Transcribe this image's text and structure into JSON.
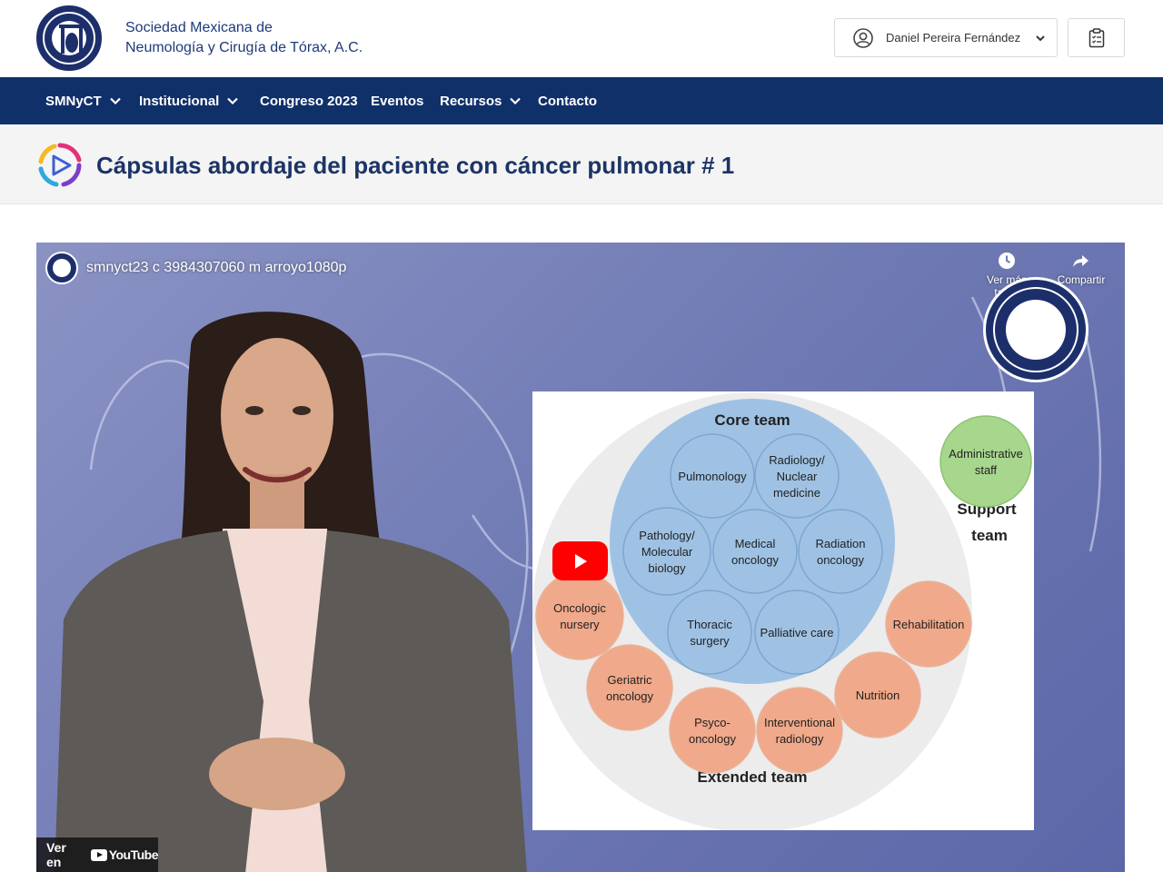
{
  "header": {
    "org_name_line1": "Sociedad Mexicana de",
    "org_name_line2": "Neumología y Cirugía de Tórax, A.C.",
    "user_name": "Daniel Pereira Fernández"
  },
  "nav": {
    "items": [
      {
        "label": "SMNyCT",
        "has_dropdown": true
      },
      {
        "label": "Institucional",
        "has_dropdown": true
      },
      {
        "label": "Congreso 2023",
        "has_dropdown": false
      },
      {
        "label": "Eventos",
        "has_dropdown": false
      },
      {
        "label": "Recursos",
        "has_dropdown": true
      },
      {
        "label": "Contacto",
        "has_dropdown": false
      }
    ]
  },
  "page": {
    "title": "Cápsulas abordaje del paciente con cáncer pulmonar # 1"
  },
  "video": {
    "title": "smnyct23 c 3984307060 m arroyo1080p",
    "watch_later_label": "Ver más tarde",
    "share_label": "Compartir",
    "watch_on_label": "Ver en",
    "youtube_label": "YouTube"
  },
  "slide": {
    "core_team_title": "Core team",
    "extended_team_title": "Extended team",
    "support_team_line1": "Support",
    "support_team_line2": "team",
    "core_circles": [
      {
        "lines": [
          "Pulmonology"
        ]
      },
      {
        "lines": [
          "Radiology/",
          "Nuclear",
          "medicine"
        ]
      },
      {
        "lines": [
          "Pathology/",
          "Molecular",
          "biology"
        ]
      },
      {
        "lines": [
          "Medical",
          "oncology"
        ]
      },
      {
        "lines": [
          "Radiation",
          "oncology"
        ]
      },
      {
        "lines": [
          "Thoracic",
          "surgery"
        ]
      },
      {
        "lines": [
          "Palliative care"
        ]
      }
    ],
    "extended_circles": [
      {
        "lines": [
          "Oncologic",
          "nursery"
        ]
      },
      {
        "lines": [
          "Geriatric",
          "oncology"
        ]
      },
      {
        "lines": [
          "Psyco-",
          "oncology"
        ]
      },
      {
        "lines": [
          "Interventional",
          "radiology"
        ]
      },
      {
        "lines": [
          "Nutrition"
        ]
      },
      {
        "lines": [
          "Rehabilitation"
        ]
      }
    ],
    "support_circle": {
      "lines": [
        "Administrative",
        "staff"
      ]
    }
  },
  "colors": {
    "nav_bg": "#10306a",
    "title_color": "#1c3466",
    "core_fill": "#9fc2e4",
    "extended_fill": "#f0a98a",
    "support_fill": "#a7d68d",
    "youtube_red": "#ff0000"
  },
  "icons": {
    "user": "user-circle-icon",
    "chevron": "chevron-down-icon",
    "clipboard": "clipboard-list-icon",
    "title": "play-ring-icon"
  }
}
